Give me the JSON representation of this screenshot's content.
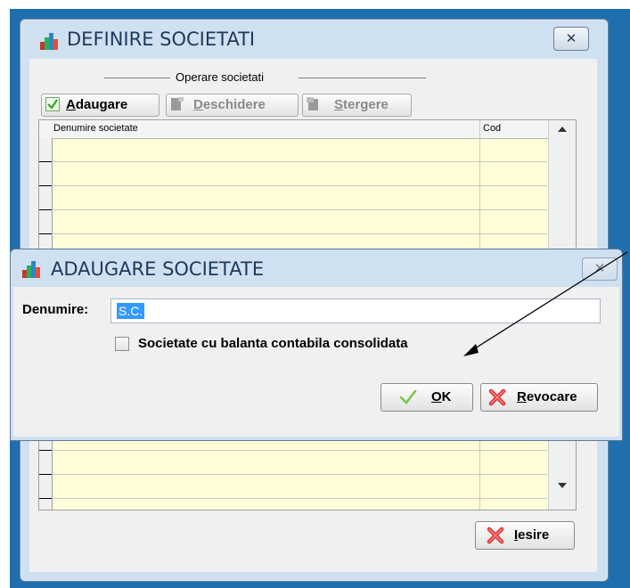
{
  "main_window": {
    "title": "DEFINIRE SOCIETATI",
    "close_glyph": "✕",
    "group_label": "Operare societati",
    "toolbar": {
      "add_prefix": "",
      "add_accel": "A",
      "add_rest": "daugare",
      "open_accel": "D",
      "open_rest": "eschidere",
      "delete_accel": "S",
      "delete_rest": "tergere"
    },
    "grid": {
      "col_name": "Denumire societate",
      "col_code": "Cod"
    },
    "exit": {
      "accel": "I",
      "rest": "esire"
    }
  },
  "dialog": {
    "title": "ADAUGARE SOCIETATE",
    "close_glyph": "✕",
    "name_label": "Denumire:",
    "name_value": "S.C.",
    "checkbox_label": "Societate cu balanta contabila consolidata",
    "ok": {
      "accel": "O",
      "rest": "K"
    },
    "cancel": {
      "accel": "R",
      "rest": "evocare"
    }
  },
  "colors": {
    "desktop": "#1f6fae",
    "titlebar": "#cfe0f1",
    "grid_background": "#fffed8",
    "selection": "#3399ff"
  }
}
